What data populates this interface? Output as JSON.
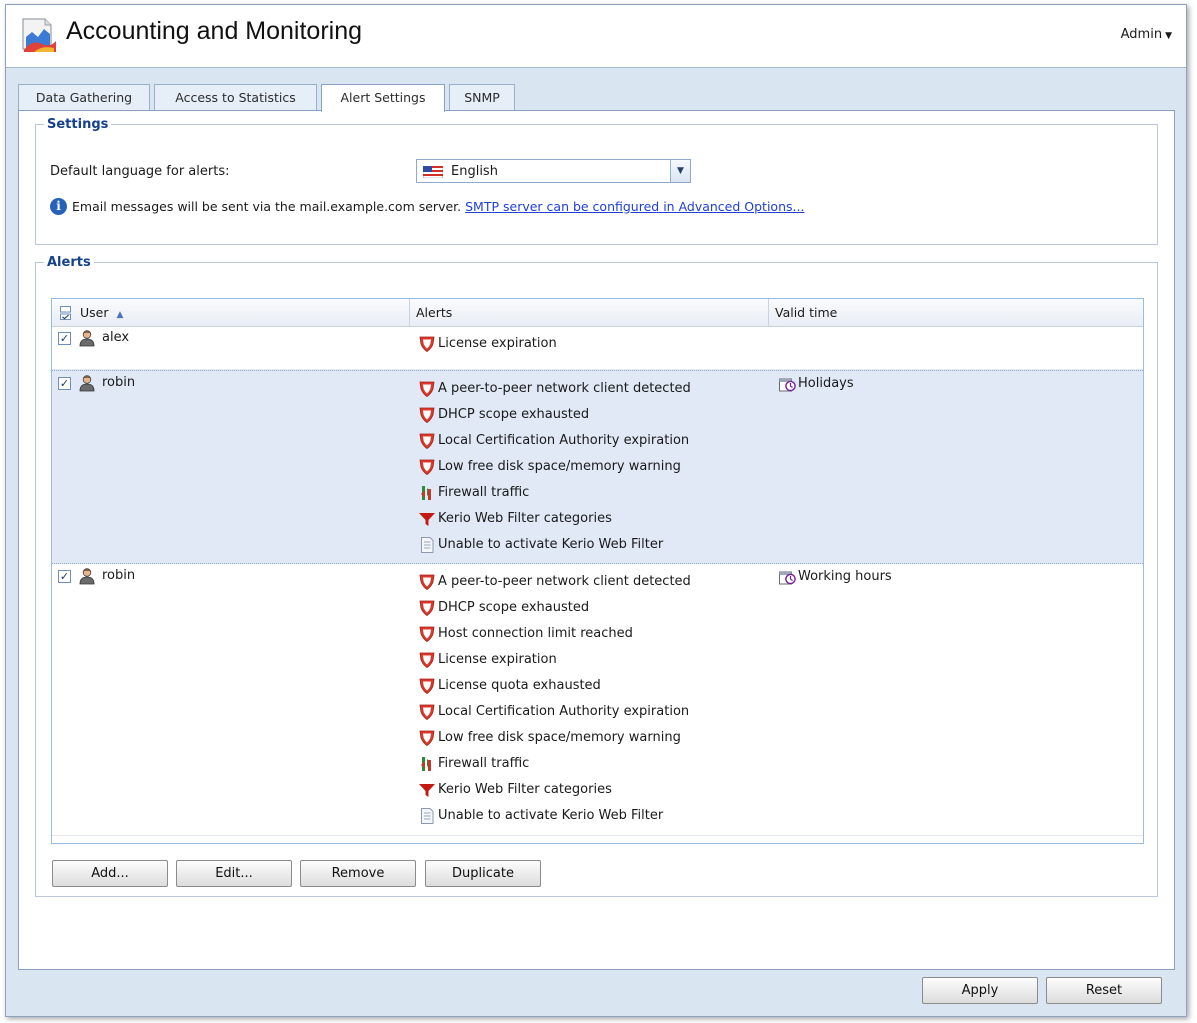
{
  "app": {
    "title": "Accounting and Monitoring",
    "user_menu": "Admin"
  },
  "tabs": [
    {
      "label": "Data Gathering",
      "active": false
    },
    {
      "label": "Access to Statistics",
      "active": false
    },
    {
      "label": "Alert Settings",
      "active": true
    },
    {
      "label": "SNMP",
      "active": false
    }
  ],
  "settings": {
    "legend": "Settings",
    "language_label": "Default language for alerts:",
    "language_value": "English",
    "info_text": "Email messages will be sent via the mail.example.com server.",
    "smtp_link": "SMTP server can be configured in Advanced Options..."
  },
  "alerts": {
    "legend": "Alerts",
    "columns": {
      "user": "User",
      "alerts": "Alerts",
      "valid_time": "Valid time"
    },
    "sort": {
      "column": "user",
      "direction": "ascending"
    },
    "rows": [
      {
        "checked": true,
        "user": "alex",
        "valid_time": "",
        "selected": false,
        "alerts": [
          {
            "icon": "shield-alert-icon",
            "text": "License expiration"
          }
        ]
      },
      {
        "checked": true,
        "user": "robin",
        "valid_time": "Holidays",
        "selected": true,
        "alerts": [
          {
            "icon": "shield-alert-icon",
            "text": "A peer-to-peer network client detected"
          },
          {
            "icon": "shield-alert-icon",
            "text": "DHCP scope exhausted"
          },
          {
            "icon": "shield-alert-icon",
            "text": "Local Certification Authority expiration"
          },
          {
            "icon": "shield-alert-icon",
            "text": "Low free disk space/memory warning"
          },
          {
            "icon": "firewall-traffic-icon",
            "text": "Firewall traffic"
          },
          {
            "icon": "funnel-filter-icon",
            "text": "Kerio Web Filter categories"
          },
          {
            "icon": "document-icon",
            "text": "Unable to activate Kerio Web Filter"
          }
        ]
      },
      {
        "checked": true,
        "user": "robin",
        "valid_time": "Working hours",
        "selected": false,
        "alerts": [
          {
            "icon": "shield-alert-icon",
            "text": "A peer-to-peer network client detected"
          },
          {
            "icon": "shield-alert-icon",
            "text": "DHCP scope exhausted"
          },
          {
            "icon": "shield-alert-icon",
            "text": "Host connection limit reached"
          },
          {
            "icon": "shield-alert-icon",
            "text": "License expiration"
          },
          {
            "icon": "shield-alert-icon",
            "text": "License quota exhausted"
          },
          {
            "icon": "shield-alert-icon",
            "text": "Local Certification Authority expiration"
          },
          {
            "icon": "shield-alert-icon",
            "text": "Low free disk space/memory warning"
          },
          {
            "icon": "firewall-traffic-icon",
            "text": "Firewall traffic"
          },
          {
            "icon": "funnel-filter-icon",
            "text": "Kerio Web Filter categories"
          },
          {
            "icon": "document-icon",
            "text": "Unable to activate Kerio Web Filter"
          }
        ]
      }
    ],
    "buttons": {
      "add": "Add...",
      "edit": "Edit...",
      "remove": "Remove",
      "duplicate": "Duplicate"
    }
  },
  "footer": {
    "apply": "Apply",
    "reset": "Reset"
  },
  "colors": {
    "accent": "#15428b",
    "alert_red": "#d9392b",
    "selection": "#e0e9f5",
    "link": "#1f3fd8",
    "body_bg": "#dae5f2"
  }
}
